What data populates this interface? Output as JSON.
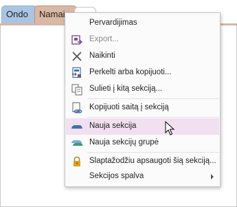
{
  "tabs": [
    {
      "label": "Ondo"
    },
    {
      "label": "Namai"
    }
  ],
  "context_menu": {
    "items": [
      {
        "label": "Pervardijimas",
        "icon": "none"
      },
      {
        "label": "Export...",
        "icon": "export-icon",
        "disabled": true
      },
      {
        "label": "Naikinti",
        "icon": "delete-x-icon"
      },
      {
        "label": "Perkelti arba kopijuoti...",
        "icon": "move-copy-icon"
      },
      {
        "label": "Sulieti į kitą sekciją...",
        "icon": "merge-icon"
      },
      {
        "label": "Kopijuoti saitą į sekciją",
        "icon": "link-icon"
      },
      {
        "label": "Nauja sekcija",
        "icon": "new-section-icon",
        "highlighted": true
      },
      {
        "label": "Nauja sekcijų grupė",
        "icon": "section-group-icon"
      },
      {
        "label": "Slaptažodžiu apsaugoti šią sekciją...",
        "icon": "lock-icon"
      },
      {
        "label": "Sekcijos spalva",
        "icon": "none",
        "submenu": true
      }
    ]
  },
  "colors": {
    "menu_highlight": "#f1e0ef",
    "tab_ondo": "#a9c5e3",
    "tab_namai": "#d9b8a4",
    "icon_purple": "#7b4fa3",
    "icon_blue": "#3d6fb4",
    "lock_gold": "#d8a020"
  }
}
